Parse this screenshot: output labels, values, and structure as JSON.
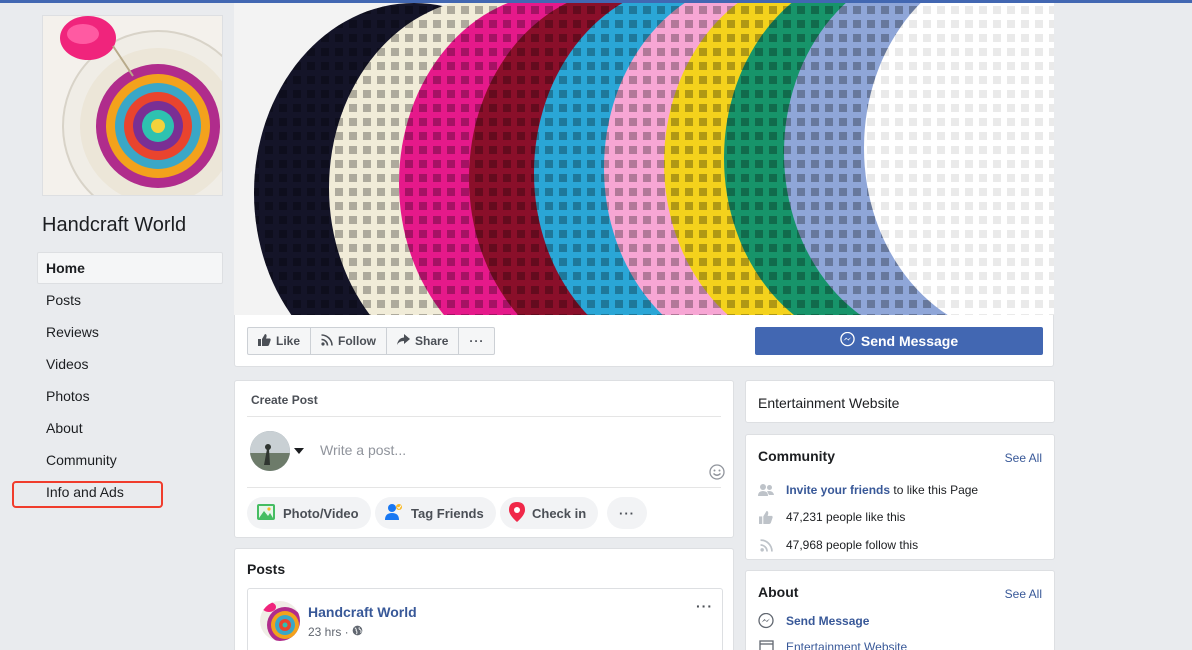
{
  "page": {
    "name": "Handcraft World",
    "accent_color": "#4267b2"
  },
  "sidebar": {
    "items": [
      {
        "label": "Home",
        "active": true
      },
      {
        "label": "Posts"
      },
      {
        "label": "Reviews"
      },
      {
        "label": "Videos"
      },
      {
        "label": "Photos"
      },
      {
        "label": "About"
      },
      {
        "label": "Community"
      },
      {
        "label": "Info and Ads",
        "highlighted": true
      }
    ]
  },
  "actions": {
    "like": "Like",
    "follow": "Follow",
    "share": "Share",
    "more": "···",
    "send_message": "Send Message"
  },
  "create_post": {
    "title": "Create Post",
    "placeholder": "Write a post...",
    "buttons": {
      "photo_video": "Photo/Video",
      "tag_friends": "Tag Friends",
      "check_in": "Check in",
      "more": "···"
    }
  },
  "posts": {
    "title": "Posts",
    "first": {
      "author": "Handcraft World",
      "time": "23 hrs ·",
      "more": "···"
    }
  },
  "right": {
    "category": "Entertainment Website",
    "community": {
      "title": "Community",
      "see_all": "See All",
      "invite_link": "Invite your friends",
      "invite_rest": "to like this Page",
      "likes": "47,231 people like this",
      "follows": "47,968 people follow this"
    },
    "about": {
      "title": "About",
      "see_all": "See All",
      "send_message": "Send Message",
      "website": "Entertainment Website"
    }
  }
}
